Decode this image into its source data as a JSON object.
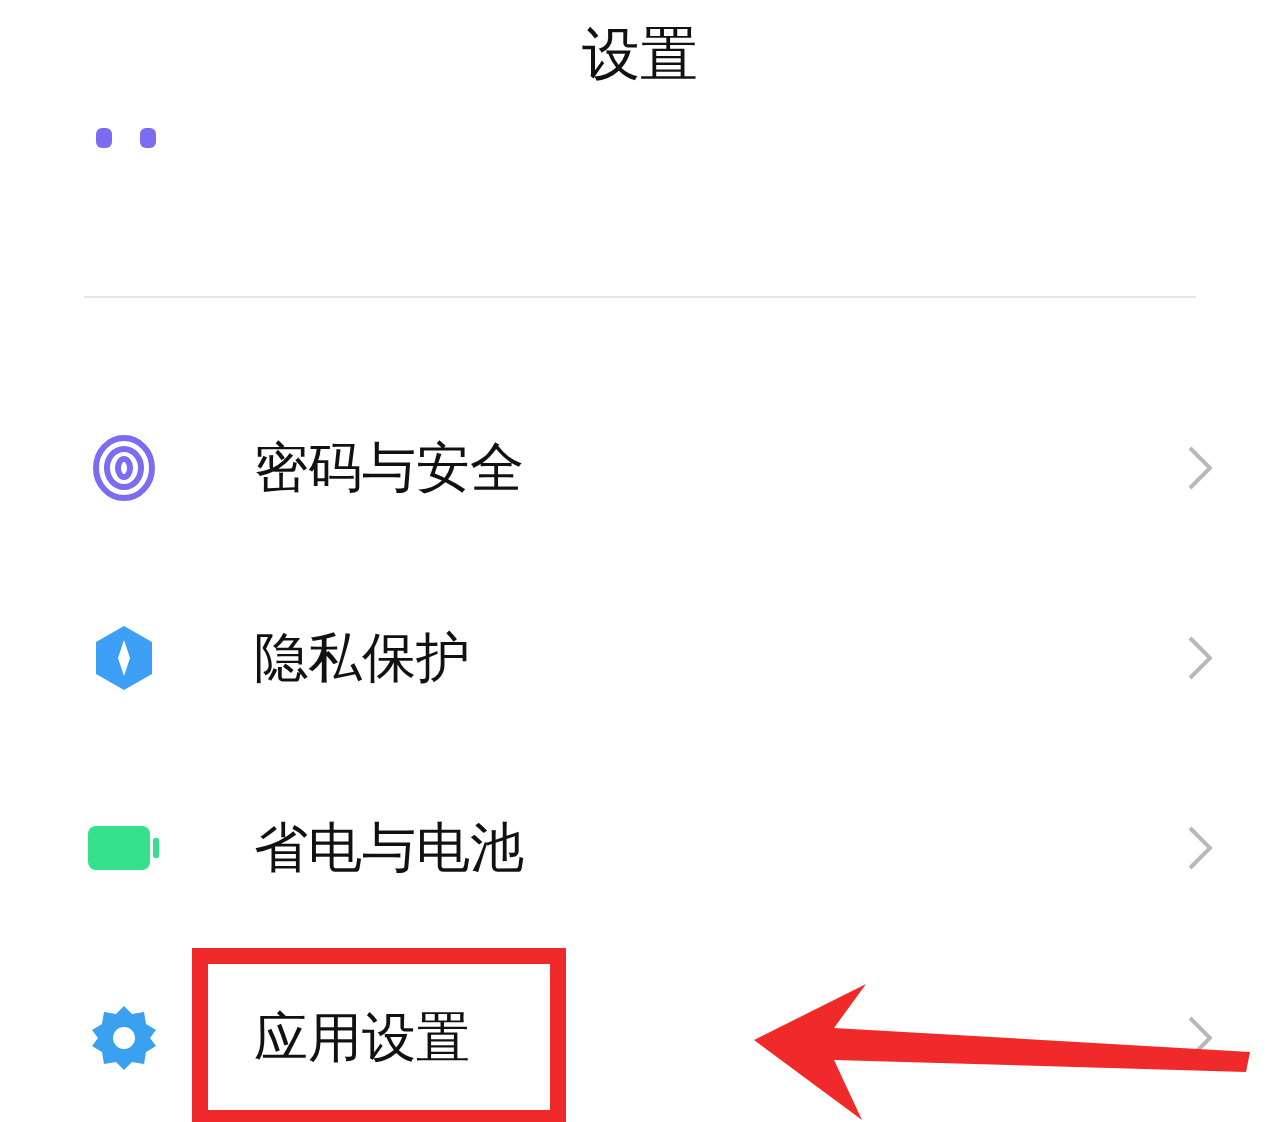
{
  "title": "设置",
  "items": [
    {
      "kind": "fingerprint",
      "label": "密码与安全",
      "highlighted": false
    },
    {
      "kind": "privacy",
      "label": "隐私保护",
      "highlighted": false
    },
    {
      "kind": "battery",
      "label": "省电与电池",
      "highlighted": false
    },
    {
      "kind": "gear",
      "label": "应用设置",
      "highlighted": true
    }
  ]
}
